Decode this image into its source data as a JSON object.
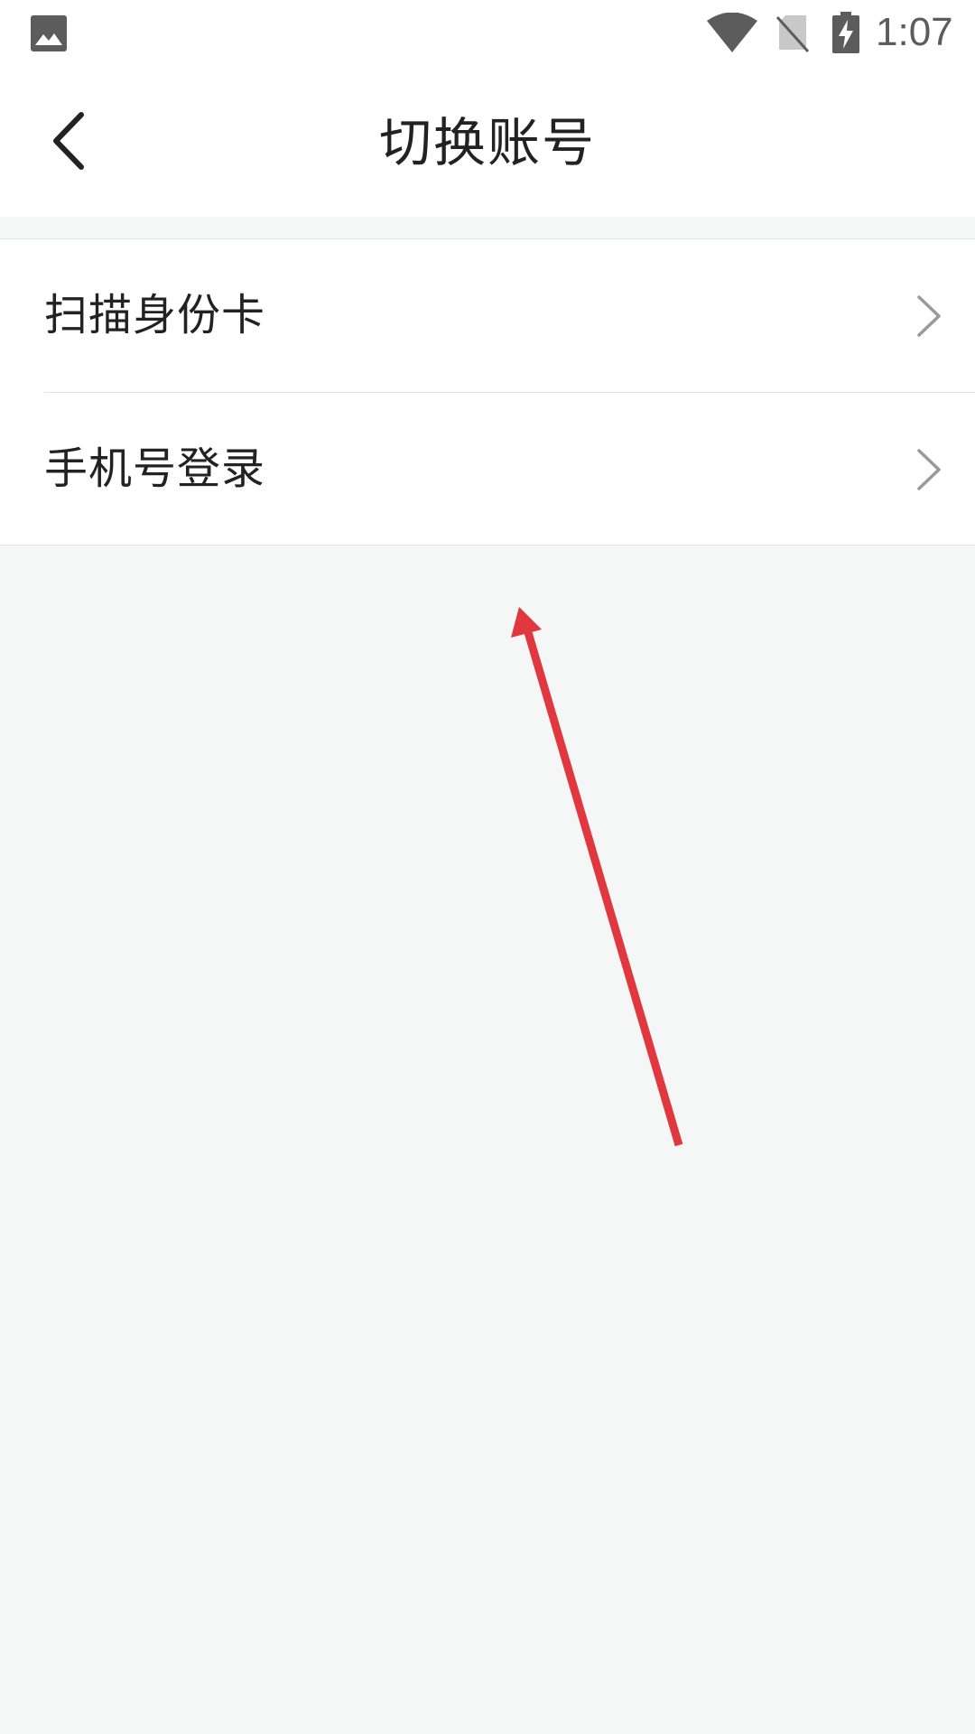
{
  "status_bar": {
    "time": "1:07",
    "icons": [
      "gallery-icon",
      "wifi-icon",
      "no-sim-icon",
      "battery-charging-icon"
    ]
  },
  "header": {
    "title": "切换账号",
    "back_icon": "chevron-left-icon"
  },
  "menu": {
    "items": [
      {
        "label": "扫描身份卡",
        "icon": "chevron-right-icon"
      },
      {
        "label": "手机号登录",
        "icon": "chevron-right-icon"
      }
    ]
  },
  "annotation": {
    "type": "arrow",
    "color": "#e0383e"
  },
  "colors": {
    "background": "#f5f6f6",
    "surface": "#ffffff",
    "divider": "#e3e3e3",
    "text_primary": "#222222",
    "chevron": "#9a9a9a",
    "annotation": "#e0383e"
  }
}
